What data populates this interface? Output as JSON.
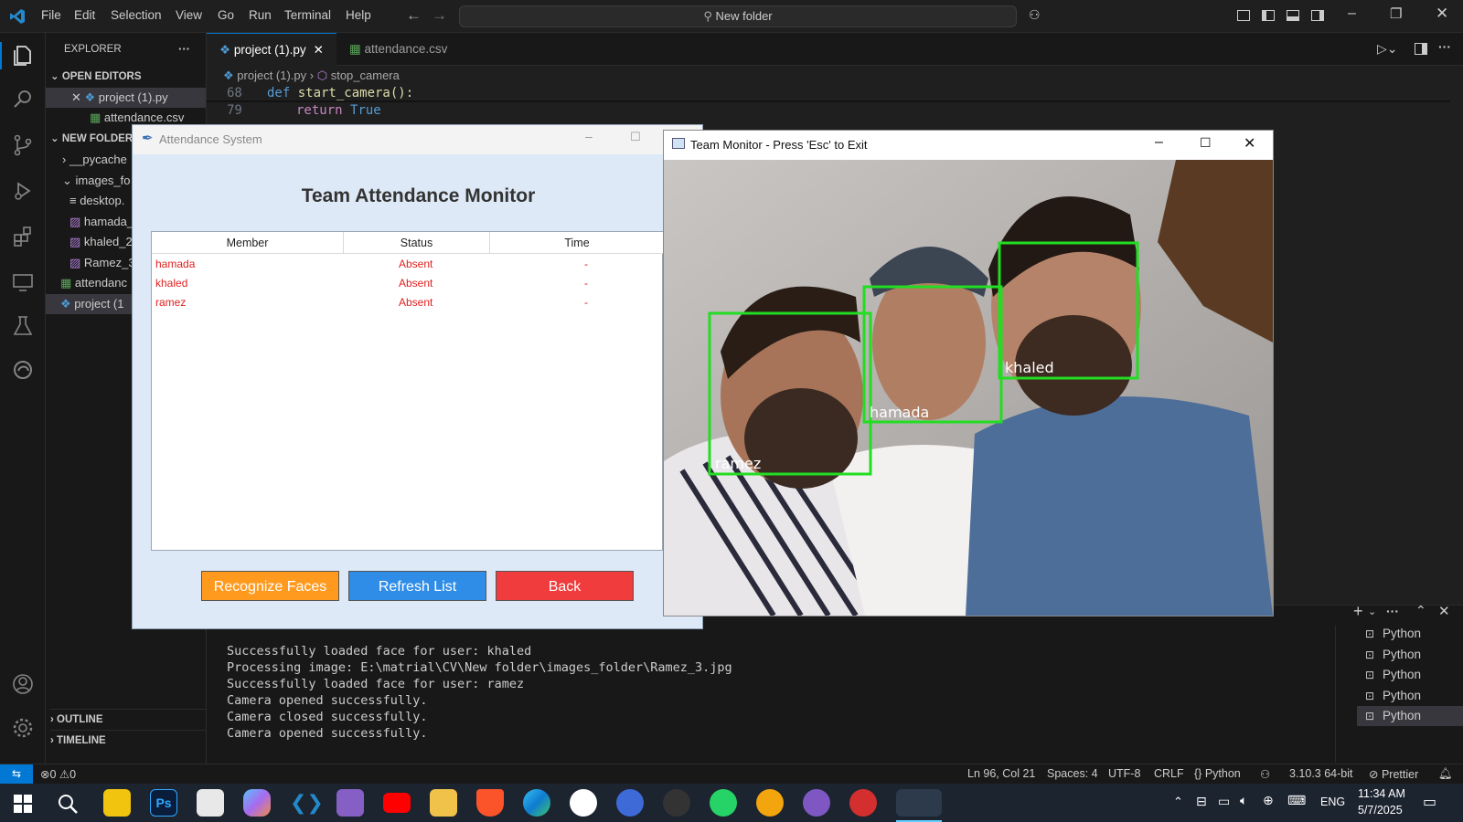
{
  "menu": [
    "File",
    "Edit",
    "Selection",
    "View",
    "Go",
    "Run",
    "Terminal",
    "Help"
  ],
  "command_center": "New folder",
  "sidebar": {
    "explorer_title": "EXPLORER",
    "open_editors": "OPEN EDITORS",
    "open_files": [
      "project (1).py",
      "attendance.csv"
    ],
    "folder": "NEW FOLDER",
    "tree": [
      "__pycache",
      "images_fo",
      "desktop.",
      "hamada_",
      "khaled_2",
      "Ramez_3",
      "attendanc",
      "project (1"
    ],
    "outline": "OUTLINE",
    "timeline": "TIMELINE"
  },
  "tabs": [
    "project (1).py",
    "attendance.csv"
  ],
  "breadcrumb": [
    "project (1).py",
    "stop_camera"
  ],
  "code": [
    {
      "line": "68",
      "text": "def start_camera():"
    },
    {
      "line": "79",
      "text": "return True"
    }
  ],
  "terminal": {
    "lines": [
      "Successfully loaded face for user: khaled",
      "Processing image: E:\\matrial\\CV\\New folder\\images_folder\\Ramez_3.jpg",
      "Successfully loaded face for user: ramez",
      "Camera opened successfully.",
      "Camera closed successfully.",
      "Camera opened successfully."
    ],
    "instances": [
      "Python",
      "Python",
      "Python",
      "Python",
      "Python"
    ]
  },
  "statusbar": {
    "errors": "0",
    "warnings": "0",
    "position": "Ln 96, Col 21",
    "spaces": "Spaces: 4",
    "encoding": "UTF-8",
    "eol": "CRLF",
    "language": "Python",
    "interpreter": "3.10.3 64-bit",
    "formatter": "Prettier"
  },
  "taskbar": {
    "lang": "ENG",
    "time": "11:34 AM",
    "date": "5/7/2025"
  },
  "attendance_window": {
    "title": "Attendance System",
    "heading": "Team Attendance Monitor",
    "columns": [
      "Member",
      "Status",
      "Time"
    ],
    "rows": [
      {
        "member": "hamada",
        "status": "Absent",
        "time": "-"
      },
      {
        "member": "khaled",
        "status": "Absent",
        "time": "-"
      },
      {
        "member": "ramez",
        "status": "Absent",
        "time": "-"
      }
    ],
    "buttons": {
      "recognize": "Recognize Faces",
      "refresh": "Refresh List",
      "back": "Back"
    },
    "colors": {
      "recognize": "#ff9a1f",
      "refresh": "#2f8de8",
      "back": "#f03c3c"
    }
  },
  "monitor_window": {
    "title": "Team Monitor - Press 'Esc' to Exit",
    "faces": [
      "ramez",
      "hamada",
      "khaled"
    ]
  },
  "colors": {
    "accent": "#0078d4",
    "face_box": "#22dd22"
  }
}
